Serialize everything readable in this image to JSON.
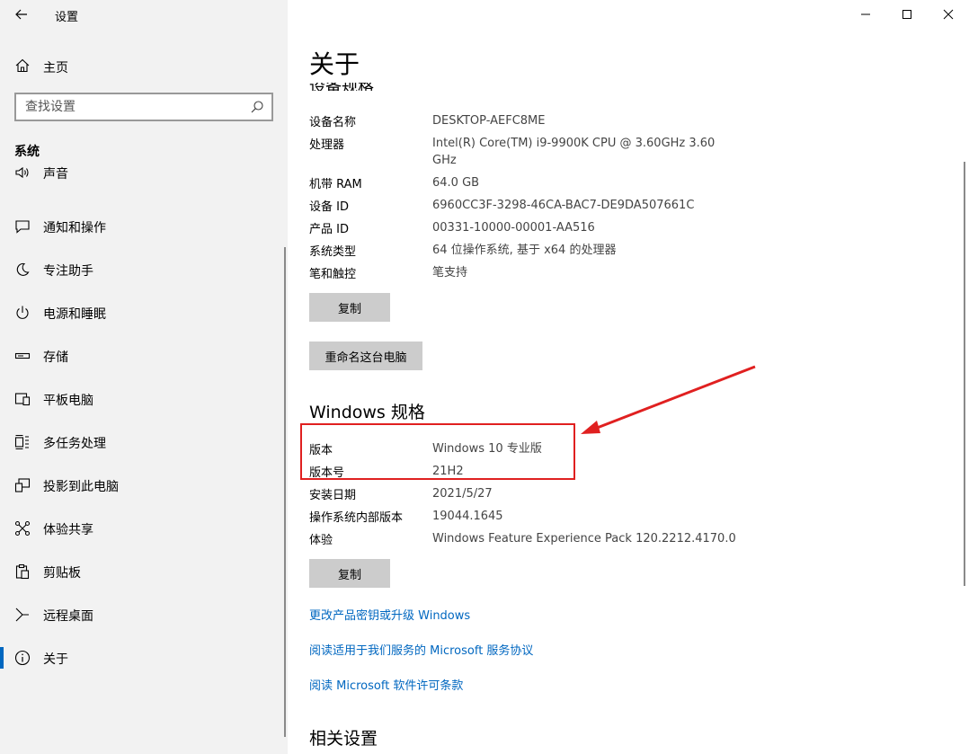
{
  "window": {
    "app_title": "设置"
  },
  "sidebar": {
    "home_label": "主页",
    "search_placeholder": "查找设置",
    "section": "系统",
    "items": [
      {
        "label": "声音",
        "icon": "speaker-icon"
      },
      {
        "label": "通知和操作",
        "icon": "notification-icon"
      },
      {
        "label": "专注助手",
        "icon": "moon-icon"
      },
      {
        "label": "电源和睡眠",
        "icon": "power-icon"
      },
      {
        "label": "存储",
        "icon": "storage-icon"
      },
      {
        "label": "平板电脑",
        "icon": "tablet-icon"
      },
      {
        "label": "多任务处理",
        "icon": "multitask-icon"
      },
      {
        "label": "投影到此电脑",
        "icon": "project-icon"
      },
      {
        "label": "体验共享",
        "icon": "share-icon"
      },
      {
        "label": "剪贴板",
        "icon": "clipboard-icon"
      },
      {
        "label": "远程桌面",
        "icon": "remote-icon"
      },
      {
        "label": "关于",
        "icon": "info-icon"
      }
    ]
  },
  "main": {
    "page_title": "关于",
    "clipped_heading": "设备规格",
    "device_specs": [
      {
        "key": "设备名称",
        "value": "DESKTOP-AEFC8ME"
      },
      {
        "key": "处理器",
        "value": "Intel(R) Core(TM) i9-9900K CPU @ 3.60GHz   3.60 GHz"
      },
      {
        "key": "机带 RAM",
        "value": "64.0 GB"
      },
      {
        "key": "设备 ID",
        "value": "6960CC3F-3298-46CA-BAC7-DE9DA507661C"
      },
      {
        "key": "产品 ID",
        "value": "00331-10000-00001-AA516"
      },
      {
        "key": "系统类型",
        "value": "64 位操作系统, 基于 x64 的处理器"
      },
      {
        "key": "笔和触控",
        "value": "笔支持"
      }
    ],
    "copy_button": "复制",
    "rename_button": "重命名这台电脑",
    "windows_heading": "Windows 规格",
    "windows_specs": [
      {
        "key": "版本",
        "value": "Windows 10 专业版"
      },
      {
        "key": "版本号",
        "value": "21H2"
      },
      {
        "key": "安装日期",
        "value": "2021/5/27"
      },
      {
        "key": "操作系统内部版本",
        "value": "19044.1645"
      },
      {
        "key": "体验",
        "value": "Windows Feature Experience Pack 120.2212.4170.0"
      }
    ],
    "copy_button_2": "复制",
    "links": [
      "更改产品密钥或升级 Windows",
      "阅读适用于我们服务的 Microsoft 服务协议",
      "阅读 Microsoft 软件许可条款"
    ],
    "related_heading": "相关设置"
  },
  "colors": {
    "accent": "#0067c0",
    "sidebar_bg": "#f2f2f2",
    "button_bg": "#cccccc",
    "annotation": "#e02020"
  }
}
